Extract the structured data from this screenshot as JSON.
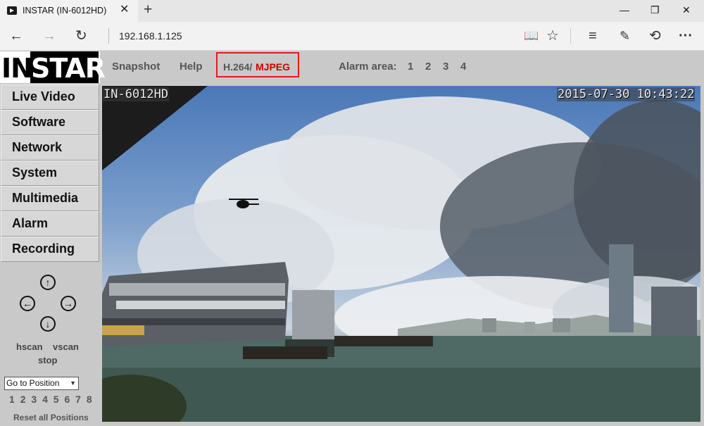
{
  "browser": {
    "tab_title": "INSTAR (IN-6012HD)",
    "tab_close": "✕",
    "new_tab": "+",
    "address": "192.168.1.125",
    "window_controls": {
      "minimize": "—",
      "restore": "❐",
      "close": "✕"
    },
    "nav_icons": [
      "back-icon",
      "forward-icon",
      "refresh-icon",
      "reading-view-icon",
      "favorite-star-icon",
      "hub-icon",
      "web-note-icon",
      "share-icon",
      "more-icon"
    ],
    "nav_glyphs": {
      "back": "←",
      "forward": "→",
      "refresh": "↻",
      "reading": "📖",
      "star": "☆",
      "hub": "≡",
      "note": "✎",
      "share": "⟲",
      "more": "···"
    }
  },
  "logo": {
    "part1": "IN",
    "part2": "STAR"
  },
  "topmenu": {
    "snapshot": "Snapshot",
    "help": "Help",
    "codec_h264": "H.264/",
    "codec_mjpeg": "MJPEG",
    "alarm_area_label": "Alarm area:",
    "alarm_areas": [
      "1",
      "2",
      "3",
      "4"
    ]
  },
  "sidebar": {
    "items": [
      "Live Video",
      "Software",
      "Network",
      "System",
      "Multimedia",
      "Alarm",
      "Recording"
    ]
  },
  "ptz": {
    "up": "↑",
    "down": "↓",
    "left": "←",
    "right": "→",
    "hscan": "hscan",
    "vscan": "vscan",
    "stop": "stop",
    "goto_position": "Go to Position",
    "positions": [
      "1",
      "2",
      "3",
      "4",
      "5",
      "6",
      "7",
      "8"
    ],
    "reset": "Reset all Positions"
  },
  "video": {
    "camera_name": "IN-6012HD",
    "timestamp": "2015-07-30 10:43:22"
  }
}
